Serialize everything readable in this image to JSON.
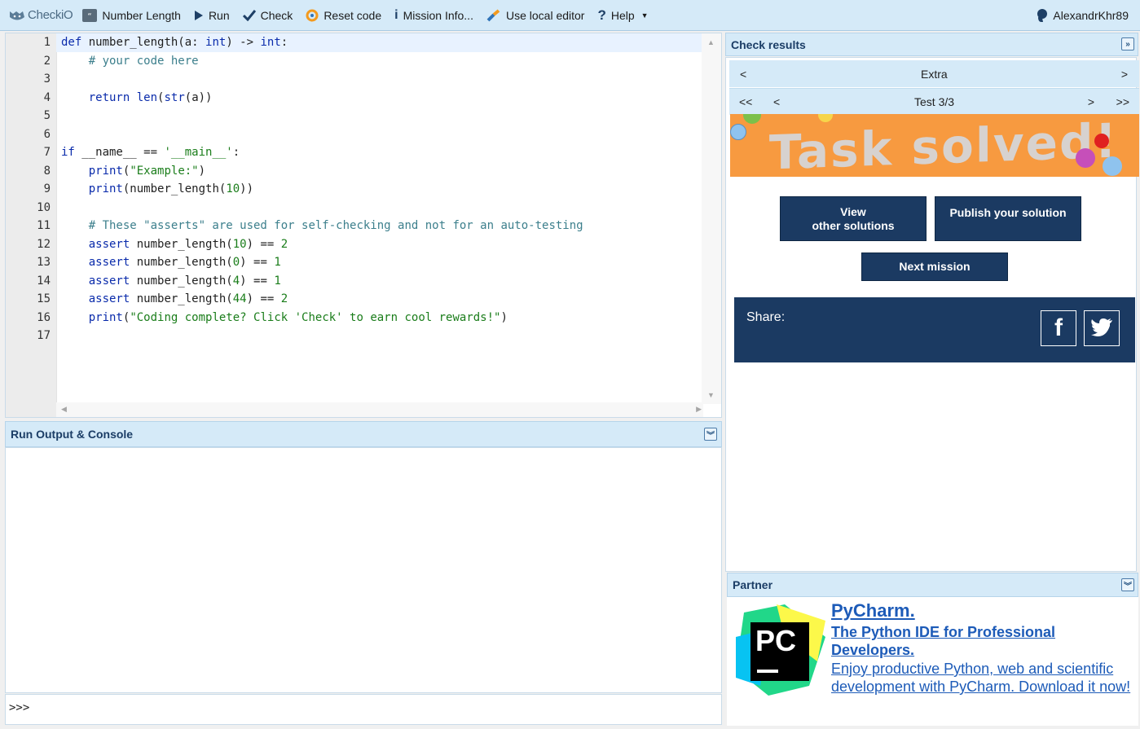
{
  "toolbar": {
    "logo": "CheckiO",
    "items": [
      {
        "label": "Number Length",
        "icon": "quote-icon"
      },
      {
        "label": "Run",
        "icon": "play-icon"
      },
      {
        "label": "Check",
        "icon": "check-icon"
      },
      {
        "label": "Reset code",
        "icon": "reset-icon"
      },
      {
        "label": "Mission Info...",
        "icon": "info-icon"
      },
      {
        "label": "Use local editor",
        "icon": "local-editor-icon"
      },
      {
        "label": "Help",
        "icon": "help-icon"
      }
    ],
    "user": "AlexandrKhr89"
  },
  "editor": {
    "line_numbers": [
      "1",
      "2",
      "3",
      "4",
      "5",
      "6",
      "7",
      "8",
      "9",
      "10",
      "11",
      "12",
      "13",
      "14",
      "15",
      "16",
      "17"
    ],
    "lines": [
      "def number_length(a: int) -> int:",
      "    # your code here",
      "",
      "    return len(str(a))",
      "",
      "",
      "if __name__ == '__main__':",
      "    print(\"Example:\")",
      "    print(number_length(10))",
      "",
      "    # These \"asserts\" are used for self-checking and not for an auto-testing",
      "    assert number_length(10) == 2",
      "    assert number_length(0) == 1",
      "    assert number_length(4) == 1",
      "    assert number_length(44) == 2",
      "    print(\"Coding complete? Click 'Check' to earn cool rewards!\")",
      ""
    ]
  },
  "console": {
    "title": "Run Output & Console",
    "prompt": ">>>"
  },
  "results": {
    "title": "Check results",
    "category_prev": "<",
    "category": "Extra",
    "category_next": ">",
    "first": "<<",
    "prev": "<",
    "test_label": "Test 3/3",
    "next": ">",
    "last": ">>",
    "banner_text": "Task solved!",
    "view_solutions_line1": "View",
    "view_solutions_line2": "other solutions",
    "publish": "Publish your solution",
    "next_mission": "Next mission",
    "share_label": "Share:"
  },
  "partner": {
    "title": "Partner",
    "logo_text": "PC",
    "product": "PyCharm.",
    "tagline": "The Python IDE for Professional Developers.",
    "description": "Enjoy productive Python, web and scientific development with PyCharm. Download it now!"
  }
}
